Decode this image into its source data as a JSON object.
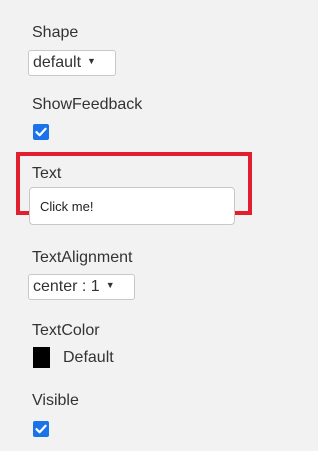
{
  "properties": {
    "shape": {
      "label": "Shape",
      "value": "default"
    },
    "show_feedback": {
      "label": "ShowFeedback",
      "checked": true
    },
    "text": {
      "label": "Text",
      "value": "Click me!"
    },
    "text_alignment": {
      "label": "TextAlignment",
      "value": "center : 1"
    },
    "text_color": {
      "label": "TextColor",
      "value": "Default",
      "color": "#000000"
    },
    "visible": {
      "label": "Visible",
      "checked": true
    }
  },
  "colors": {
    "checkbox": "#1a73e8",
    "highlight": "#e0202e",
    "panel_bg": "#f2f2f2"
  }
}
